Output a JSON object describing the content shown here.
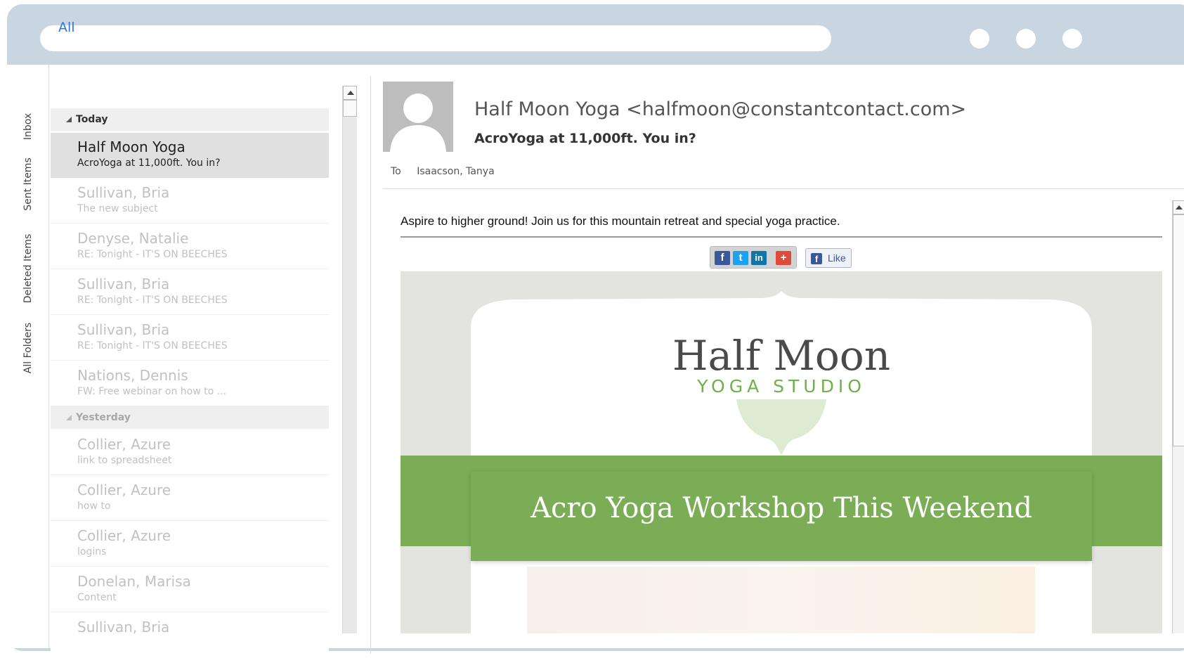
{
  "folders": [
    "Inbox",
    "Sent Items",
    "Deleted Items",
    "All Folders"
  ],
  "list": {
    "filter": "All",
    "groups": [
      {
        "label": "Today"
      },
      {
        "label": "Yesterday"
      }
    ],
    "messages": [
      {
        "sender": "Half Moon Yoga",
        "subject": "AcroYoga at 11,000ft. You in?"
      },
      {
        "sender": "Sullivan, Bria",
        "subject": "The new subject"
      },
      {
        "sender": "Denyse, Natalie",
        "subject": "RE: Tonight - IT'S ON BEECHES"
      },
      {
        "sender": "Sullivan, Bria",
        "subject": "RE: Tonight - IT'S ON BEECHES"
      },
      {
        "sender": "Sullivan, Bria",
        "subject": "RE: Tonight - IT'S ON BEECHES"
      },
      {
        "sender": "Nations, Dennis",
        "subject": "FW: Free webinar on how to ..."
      },
      {
        "sender": "Collier, Azure",
        "subject": "link to spreadsheet"
      },
      {
        "sender": "Collier, Azure",
        "subject": "how to"
      },
      {
        "sender": "Collier, Azure",
        "subject": "logins"
      },
      {
        "sender": "Donelan, Marisa",
        "subject": "Content"
      },
      {
        "sender": "Sullivan, Bria",
        "subject": ""
      }
    ]
  },
  "reading": {
    "from": "Half Moon Yoga <halfmoon@constantcontact.com>",
    "subject": "AcroYoga at 11,000ft. You in?",
    "to_label": "To",
    "to_value": "Isaacson, Tanya",
    "preheader": "Aspire to higher ground! Join us for this mountain retreat and special yoga practice.",
    "share": {
      "fb": "f",
      "tw": "t",
      "in": "in",
      "plus": "+",
      "like_icon": "f",
      "like": "Like"
    },
    "newsletter": {
      "brand_line1": "Half Moon",
      "brand_line2": "YOGA STUDIO",
      "banner_title": "Acro Yoga Workshop This Weekend"
    }
  },
  "icons": {
    "avatar": "person-silhouette-icon",
    "share_icons": [
      "facebook-icon",
      "twitter-icon",
      "linkedin-icon",
      "google-plus-icon"
    ]
  },
  "colors": {
    "frame": "#c9d5e1",
    "accent_link": "#2a7ad6",
    "brand_green": "#7aad55",
    "brand_light_green": "#6fb04a",
    "selected_row": "#e0e0e0"
  }
}
